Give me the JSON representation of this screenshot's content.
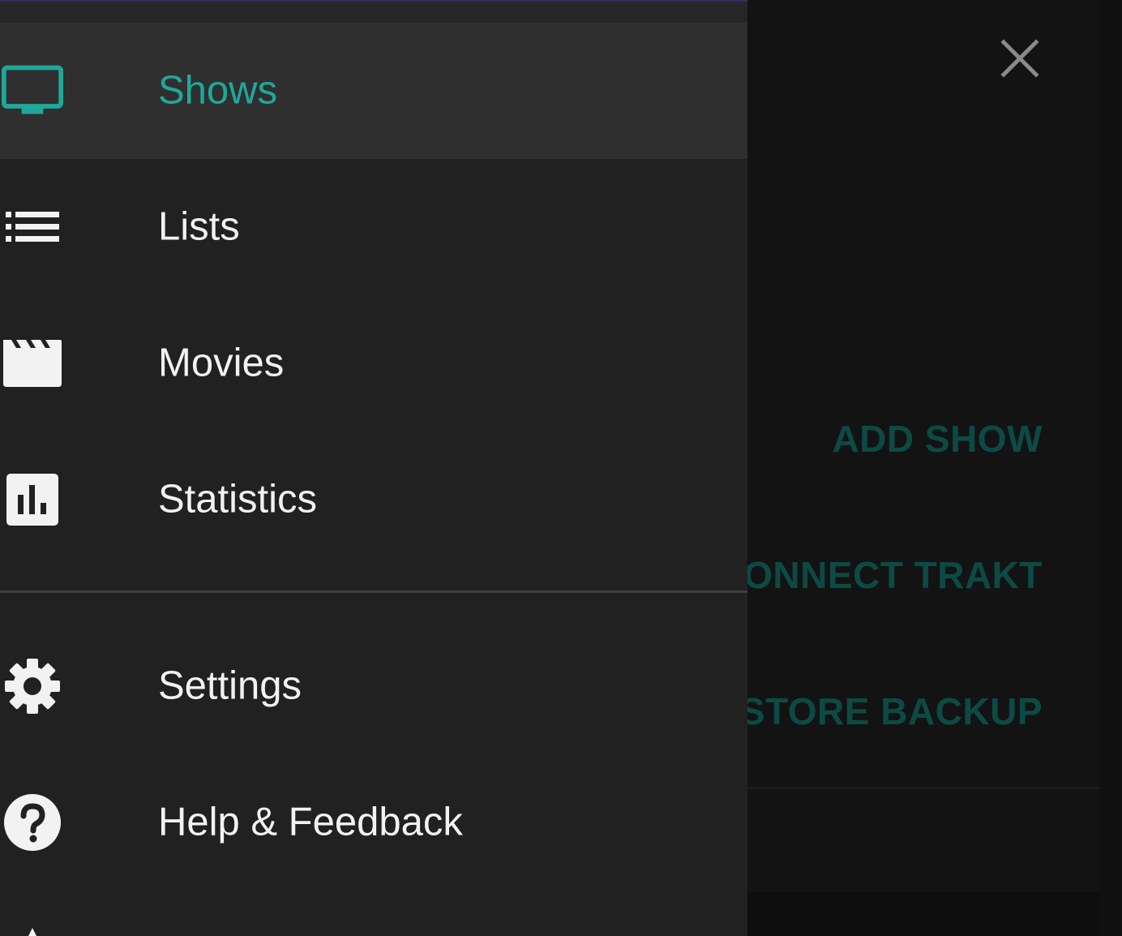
{
  "colors": {
    "accent": "#1fa89a",
    "drawer_background": "#212121",
    "active_row_background": "#2f2f2f",
    "text_primary": "#f2f2f2",
    "dimmed_accent": "#0c4a44"
  },
  "drawer": {
    "items": [
      {
        "label": "Shows",
        "icon": "tv-icon",
        "active": true
      },
      {
        "label": "Lists",
        "icon": "list-icon",
        "active": false
      },
      {
        "label": "Movies",
        "icon": "movie-clapper-icon",
        "active": false
      },
      {
        "label": "Statistics",
        "icon": "bar-chart-icon",
        "active": false
      }
    ],
    "secondary_items": [
      {
        "label": "Settings",
        "icon": "gear-icon"
      },
      {
        "label": "Help & Feedback",
        "icon": "help-circle-icon"
      }
    ]
  },
  "background": {
    "close_icon": "close-icon",
    "actions": [
      "ADD SHOW",
      "ONNECT TRAKT",
      "ESTORE BACKUP"
    ]
  }
}
